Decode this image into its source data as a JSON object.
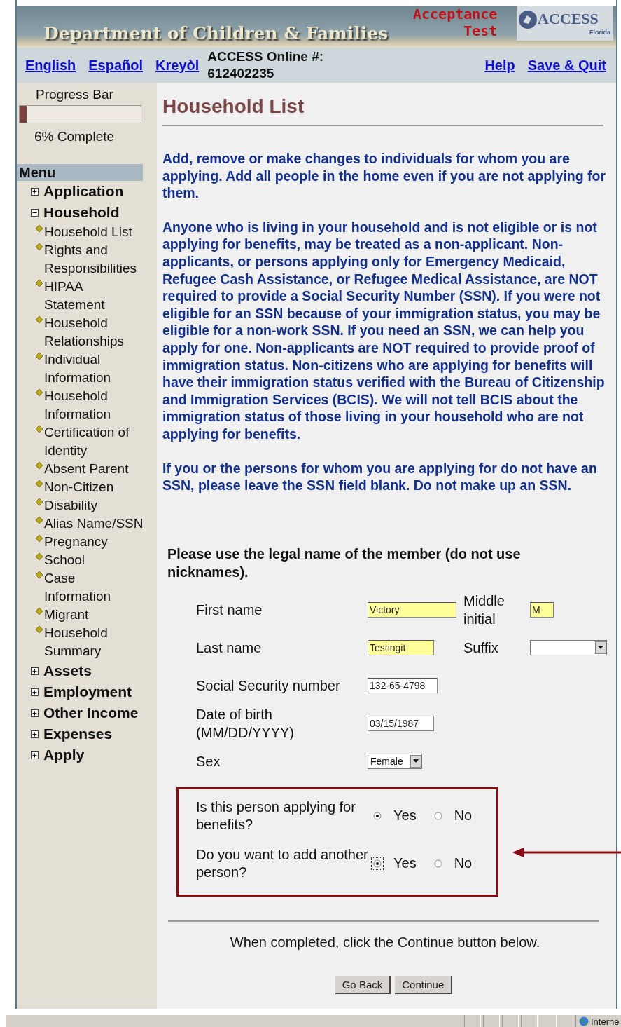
{
  "banner": {
    "title": "Department of Children & Families",
    "environment": [
      "Acceptance",
      "Test"
    ],
    "logo": {
      "word": "ACCESS",
      "sub": "Florida"
    }
  },
  "nav": {
    "languages": [
      {
        "label": "English"
      },
      {
        "label": "Español"
      },
      {
        "label": "Kreyòl"
      }
    ],
    "online_label": "ACCESS Online #:",
    "online_number": "612402235",
    "links": [
      {
        "label": "Help"
      },
      {
        "label": "Save & Quit"
      }
    ]
  },
  "sidebar": {
    "progress": {
      "title": "Progress Bar",
      "level": 0.06,
      "reading": "6% Complete"
    },
    "menu_title": "Menu",
    "items": [
      {
        "label": "Application",
        "expanded": false
      },
      {
        "label": "Household",
        "expanded": true,
        "children": [
          {
            "label": "Household List"
          },
          {
            "label": "Rights and Responsibilities"
          },
          {
            "label": "HIPAA Statement"
          },
          {
            "label": "Household Relationships"
          },
          {
            "label": "Individual Information"
          },
          {
            "label": "Household Information"
          },
          {
            "label": "Certification of Identity"
          },
          {
            "label": "Absent Parent"
          },
          {
            "label": "Non-Citizen"
          },
          {
            "label": "Disability"
          },
          {
            "label": "Alias Name/SSN"
          },
          {
            "label": "Pregnancy"
          },
          {
            "label": "School"
          },
          {
            "label": "Case Information"
          },
          {
            "label": "Migrant"
          },
          {
            "label": "Household Summary"
          }
        ]
      },
      {
        "label": "Assets",
        "expanded": false
      },
      {
        "label": "Employment",
        "expanded": false
      },
      {
        "label": "Other Income",
        "expanded": false
      },
      {
        "label": "Expenses",
        "expanded": false
      },
      {
        "label": "Apply",
        "expanded": false
      }
    ]
  },
  "main": {
    "title": "Household List",
    "paragraphs": [
      "Add, remove or make changes to individuals for whom you are applying. Add all people in the home even if you are not applying for them.",
      "Anyone who is living in your household and is not eligible or is not applying for benefits, may be treated as a non-applicant. Non-applicants, or persons applying only for Emergency Medicaid, Refugee Cash Assistance, or Refugee Medical Assistance, are NOT required to provide a Social Security Number (SSN). If you were not eligible for an SSN because of your immigration status, you may be eligible for a non-work SSN. If you need an SSN, we can help you apply for one. Non-applicants are NOT required to provide proof of immigration status. Non-citizens who are applying for benefits will have their immigration status verified with the Bureau of Citizenship and Immigration Services (BCIS). We will not tell BCIS about the immigration status of those living in your household who are not applying for benefits.",
      "If you or the persons for whom you are applying for do not have an SSN, please leave the SSN field blank. Do not make up an SSN."
    ],
    "form_heading": "Please use the legal name of the member (do not use nicknames).",
    "rows": [
      {
        "label": "First name",
        "value": "Victory",
        "kind": "text",
        "highlighted": true,
        "extra": {
          "label": "Middle initial",
          "value": "M",
          "kind": "text",
          "highlighted": true
        }
      },
      {
        "label": "Last name",
        "value": "Testingit",
        "kind": "text",
        "highlighted": true,
        "extra": {
          "label": "Suffix",
          "kind": "select",
          "highlighted": false
        }
      },
      {
        "label": "Social Security number",
        "value": "132-65-4798",
        "kind": "text",
        "highlighted": false
      },
      {
        "label": "Date of birth (MM/DD/YYYY)",
        "value": "03/15/1987",
        "kind": "text",
        "highlighted": false
      },
      {
        "label": "Sex",
        "value": "Female",
        "kind": "select",
        "highlighted": false
      }
    ],
    "questions": [
      {
        "label": "Is this person applying for benefits?",
        "options": [
          {
            "label": "Yes",
            "selected": true,
            "focused": false
          },
          {
            "label": "No",
            "selected": false,
            "focused": false
          }
        ]
      },
      {
        "label": "Do you want to add another person?",
        "options": [
          {
            "label": "Yes",
            "selected": true,
            "focused": true
          },
          {
            "label": "No",
            "selected": false,
            "focused": false
          }
        ]
      }
    ],
    "instruction": "When completed, click the Continue button below.",
    "buttons": [
      "Go Back",
      "Continue"
    ]
  },
  "status_bar": {
    "zone": "Interne"
  }
}
